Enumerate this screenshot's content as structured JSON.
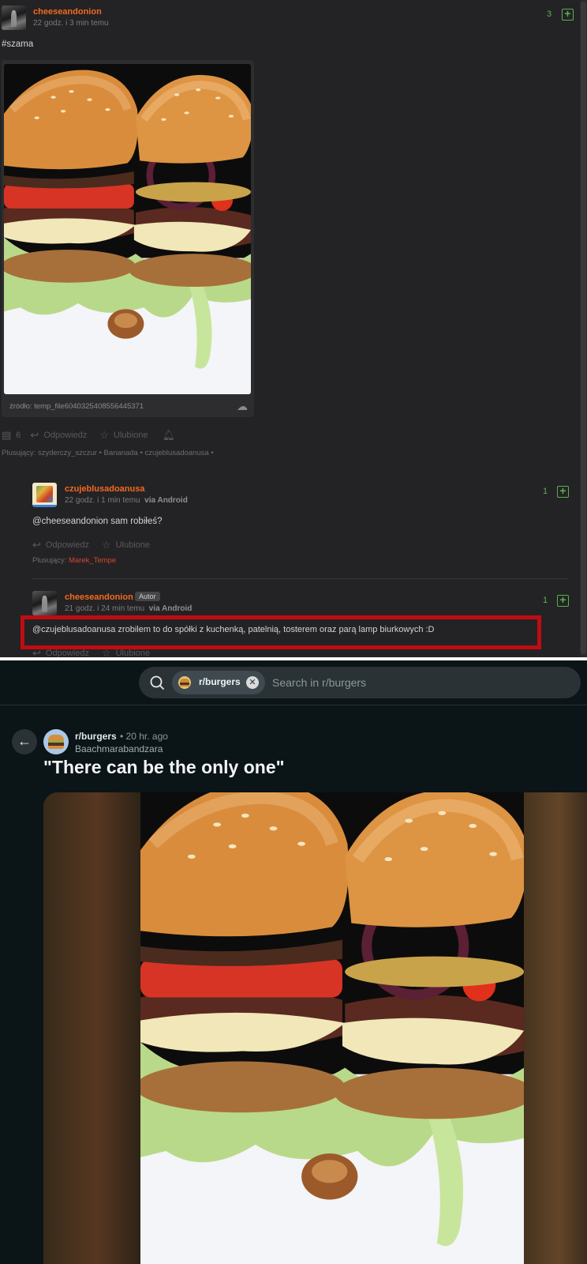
{
  "top_panel": {
    "post": {
      "author": "cheeseandonion",
      "time": "22 godz. i 3 min temu",
      "votes": "3",
      "plus_label": "+",
      "text": "#szama",
      "image_source": "źródło: temp_file6040325408556445371",
      "comments_count": "6",
      "reply_label": "Odpowiedz",
      "favorite_label": "Ulubione",
      "plusujacy_label": "Plusujący:",
      "plusujacy": "szyderczy_szczur • Bananada • czujeblusadoanusa •"
    },
    "comment1": {
      "author": "czujeblusadoanusa",
      "time": "22 godz. i 1 min temu",
      "via": "via Android",
      "votes": "1",
      "mention": "@cheeseandonion",
      "text": " sam robiłeś?",
      "reply_label": "Odpowiedz",
      "favorite_label": "Ulubione",
      "plusujacy_label": "Plusujący:",
      "plusujacy_user": "Marek_Tempe"
    },
    "comment2": {
      "author": "cheeseandonion",
      "badge": "Autor",
      "time": "21 godz. i 24 min temu",
      "via": "via Android",
      "votes": "1",
      "mention": "@czujeblusadoanusa",
      "text": " zrobilem to do spółki z kuchenką, patelnią, tosterem oraz parą lamp biurkowych :D",
      "reply_label": "Odpowiedz",
      "favorite_label": "Ulubione"
    }
  },
  "bottom_panel": {
    "search": {
      "chip_label": "r/burgers",
      "placeholder": "Search in r/burgers"
    },
    "post": {
      "subreddit": "r/burgers",
      "time": "• 20 hr. ago",
      "author": "Baachmarabandzara",
      "title": "\"There can be the only one\""
    }
  },
  "colors": {
    "accent_nick": "#f4691f",
    "vote_green": "#5ab04e",
    "highlight_red": "#c00b13",
    "reddit_bg": "#0b1416"
  }
}
